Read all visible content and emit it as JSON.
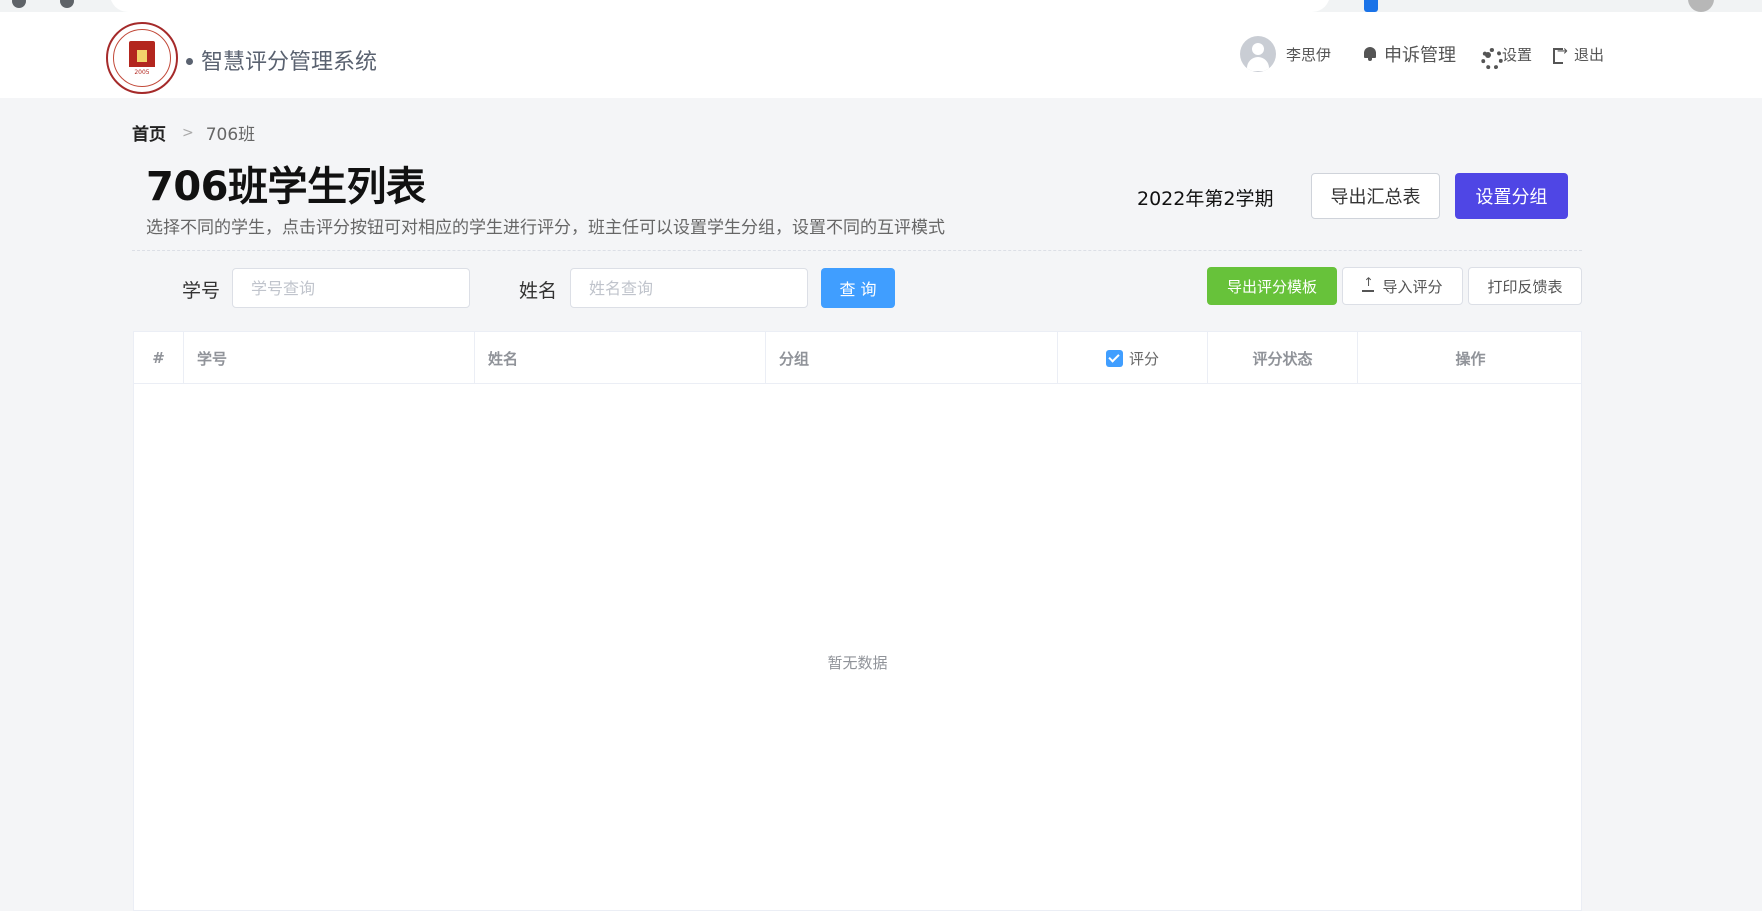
{
  "header": {
    "app_title": "智慧评分管理系统",
    "logo_year": "2005",
    "user_name": "李思伊",
    "nav": {
      "appeal": "申诉管理",
      "settings": "设置",
      "logout": "退出"
    }
  },
  "breadcrumb": {
    "home": "首页",
    "current": "706班"
  },
  "page": {
    "title": "706班学生列表",
    "description": "选择不同的学生，点击评分按钮可对相应的学生进行评分，班主任可以设置学生分组，设置不同的互评模式",
    "semester": "2022年第2学期",
    "export_summary_label": "导出汇总表",
    "set_groups_label": "设置分组"
  },
  "search": {
    "student_id_label": "学号",
    "student_id_placeholder": "学号查询",
    "student_id_value": "",
    "name_label": "姓名",
    "name_placeholder": "姓名查询",
    "name_value": "",
    "query_label": "查 询"
  },
  "actions": {
    "export_template_label": "导出评分模板",
    "import_label": "导入评分",
    "print_label": "打印反馈表"
  },
  "table": {
    "columns": {
      "index": "#",
      "student_id": "学号",
      "name": "姓名",
      "group": "分组",
      "score": "评分",
      "score_status": "评分状态",
      "operations": "操作"
    },
    "score_checkbox_checked": true,
    "rows": [],
    "empty_text": "暂无数据"
  },
  "colors": {
    "primary_purple": "#4f46e5",
    "query_blue": "#409eff",
    "export_green": "#67c23a"
  }
}
